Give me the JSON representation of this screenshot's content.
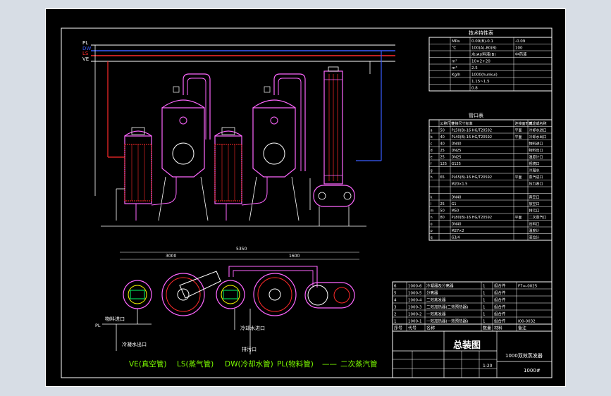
{
  "pipe_legend": {
    "pl": "PL",
    "dw": "DW",
    "ls": "LS",
    "ve": "VE"
  },
  "tech_table": {
    "title": "技术特性表",
    "rows": [
      {
        "c1": "",
        "c2": "MPa",
        "c3": "0.09(B)-0.1",
        "c4": "-0.09"
      },
      {
        "c1": "",
        "c2": "℃",
        "c3": "100(A)-80(B)",
        "c4": "100"
      },
      {
        "c1": "",
        "c2": "",
        "c3": "水(A)/料液(B)",
        "c4": "中药液"
      },
      {
        "c1": "",
        "c2": "m²",
        "c3": "10×2+20",
        "c4": ""
      },
      {
        "c1": "",
        "c2": "m³",
        "c3": "2.5",
        "c4": ""
      },
      {
        "c1": "",
        "c2": "Kg/h",
        "c3": "1000(hunkui)",
        "c4": ""
      },
      {
        "c1": "",
        "c2": "",
        "c3": "1.15~1.5",
        "c4": ""
      },
      {
        "c1": "",
        "c2": "",
        "c3": "0.8",
        "c4": ""
      }
    ]
  },
  "nozzle_table": {
    "title": "管口表",
    "head": [
      "",
      "公称尺寸",
      "连接尺寸标准",
      "连接面形式",
      "用途或名称"
    ],
    "rows": [
      [
        "a",
        "50",
        "PL50(B)-16 HG/T20592",
        "平面",
        "冷却水进口"
      ],
      [
        "b",
        "40",
        "PL40(B)-16 HG/T20592",
        "平面",
        "冷却水出口"
      ],
      [
        "c",
        "40",
        "DN40",
        "",
        "物料进口"
      ],
      [
        "d",
        "25",
        "DN25",
        "",
        "物料出口"
      ],
      [
        "e",
        "25",
        "DN25",
        "",
        "温度计口"
      ],
      [
        "f",
        "125",
        "G125",
        "",
        "视镜口"
      ],
      [
        "g",
        "",
        "",
        "",
        "冷凝水"
      ],
      [
        "h",
        "65",
        "PL65(B)-16 HG/T20592",
        "平面",
        "蒸汽进口"
      ],
      [
        "",
        "",
        "M20×1.5",
        "",
        "压力表口"
      ],
      [
        "",
        "",
        "",
        "",
        ""
      ],
      [
        "k",
        "",
        "DN40",
        "",
        "真空口"
      ],
      [
        "l",
        "25",
        "G1",
        "",
        "放空口"
      ],
      [
        "m",
        "50",
        "M50",
        "",
        "排污口"
      ],
      [
        "n",
        "80",
        "PL80(B)-16 HG/T20592",
        "平面",
        "二次蒸汽口"
      ],
      [
        "o",
        "",
        "DN40",
        "",
        "出料口"
      ],
      [
        "p",
        "",
        "M27×2",
        "",
        "温度计"
      ],
      [
        "q",
        "",
        "G3/4",
        "",
        "液位计"
      ]
    ]
  },
  "bom": {
    "rows": [
      {
        "no": "6",
        "code": "1000-6",
        "name": "冷凝器及分离器",
        "qty": "1",
        "mat": "组合件",
        "note": "F7=-0025"
      },
      {
        "no": "5",
        "code": "1000-5",
        "name": "分离器",
        "qty": "1",
        "mat": "组合件",
        "note": ""
      },
      {
        "no": "4",
        "code": "1000-4",
        "name": "二效蒸发器",
        "qty": "1",
        "mat": "组合件",
        "note": ""
      },
      {
        "no": "3",
        "code": "1000-3",
        "name": "二效加热器(二效预热器)",
        "qty": "1",
        "mat": "组合件",
        "note": ""
      },
      {
        "no": "2",
        "code": "1000-2",
        "name": "一效蒸发器",
        "qty": "1",
        "mat": "组合件",
        "note": ""
      },
      {
        "no": "1",
        "code": "1000-1",
        "name": "一效加热器(一效预热器)",
        "qty": "1",
        "mat": "组合件",
        "note": "Ⅰ00-0032"
      }
    ],
    "header": [
      "序号",
      "代号",
      "名称",
      "数量",
      "材料",
      "备注"
    ]
  },
  "title_block": {
    "main": "总装图",
    "product": "1000双效蒸发器",
    "drawing_no": "1000#",
    "scale": "1:20"
  },
  "labels": {
    "liquid_inlet": "物料进口",
    "condensate": "冷凝水出口",
    "cooling_water_in": "冷却水进口",
    "drain": "排污口",
    "pl_tag": "PL"
  },
  "legend_line": {
    "ve": "VE(真空管)",
    "ls": "LS(蒸气管)",
    "dw": "DW(冷却水管)",
    "pl": "PL(物料管)",
    "dash": "——",
    "sec": "二次蒸汽管"
  },
  "dims": {
    "plan_total": "5350",
    "d1": "3000",
    "d2": "1600"
  },
  "colors": {
    "pipe_pl": "#ffffff",
    "pipe_dw": "#3a5cff",
    "pipe_ls": "#ff2a2a",
    "pipe_ve": "#ffffff",
    "vessel": "#ff66ff",
    "detail": "#ffff00",
    "heater": "#ff2a2a",
    "text_green": "#7cfc00"
  }
}
